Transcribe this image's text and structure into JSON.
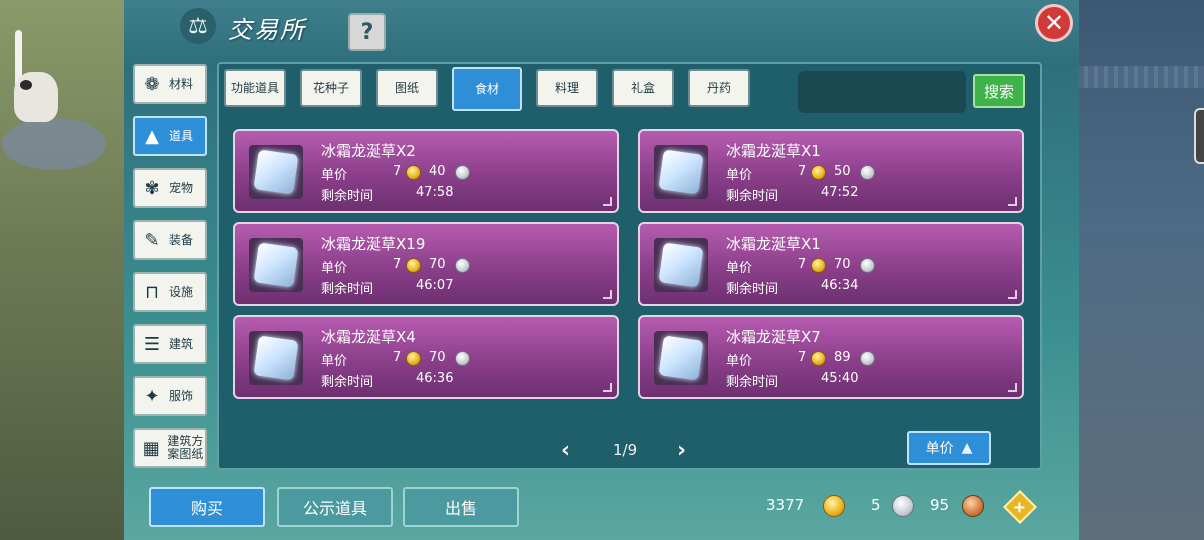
{
  "window": {
    "title": "交易所",
    "title_icon": "scale-icon",
    "help_label": "?",
    "close_label": "✕"
  },
  "sidebar": {
    "items": [
      {
        "label": "材料",
        "icon": "materials-icon",
        "glyph": "❁",
        "active": false
      },
      {
        "label": "道具",
        "icon": "props-icon",
        "glyph": "▲",
        "active": true
      },
      {
        "label": "宠物",
        "icon": "paw-icon",
        "glyph": "✾",
        "active": false
      },
      {
        "label": "装备",
        "icon": "equipment-icon",
        "glyph": "✎",
        "active": false
      },
      {
        "label": "设施",
        "icon": "facility-icon",
        "glyph": "⊓",
        "active": false
      },
      {
        "label": "建筑",
        "icon": "building-icon",
        "glyph": "☰",
        "active": false
      },
      {
        "label": "服饰",
        "icon": "clothing-icon",
        "glyph": "✦",
        "active": false
      },
      {
        "label": "建筑方案图纸",
        "icon": "blueprint-icon",
        "glyph": "▦",
        "active": false
      }
    ]
  },
  "categories": [
    {
      "label": "功能道具",
      "active": false
    },
    {
      "label": "花种子",
      "active": false
    },
    {
      "label": "图纸",
      "active": false
    },
    {
      "label": "食材",
      "active": true
    },
    {
      "label": "料理",
      "active": false
    },
    {
      "label": "礼盒",
      "active": false
    },
    {
      "label": "丹药",
      "active": false
    }
  ],
  "search": {
    "value": "",
    "button_label": "搜索"
  },
  "listings": [
    {
      "name": "冰霜龙涎草X2",
      "price_label": "单价",
      "gold": "7",
      "silver": "40",
      "time_label": "剩余时间",
      "time": "47:58"
    },
    {
      "name": "冰霜龙涎草X1",
      "price_label": "单价",
      "gold": "7",
      "silver": "50",
      "time_label": "剩余时间",
      "time": "47:52"
    },
    {
      "name": "冰霜龙涎草X19",
      "price_label": "单价",
      "gold": "7",
      "silver": "70",
      "time_label": "剩余时间",
      "time": "46:07"
    },
    {
      "name": "冰霜龙涎草X1",
      "price_label": "单价",
      "gold": "7",
      "silver": "70",
      "time_label": "剩余时间",
      "time": "46:34"
    },
    {
      "name": "冰霜龙涎草X4",
      "price_label": "单价",
      "gold": "7",
      "silver": "70",
      "time_label": "剩余时间",
      "time": "46:36"
    },
    {
      "name": "冰霜龙涎草X7",
      "price_label": "单价",
      "gold": "7",
      "silver": "89",
      "time_label": "剩余时间",
      "time": "45:40"
    }
  ],
  "pagination": {
    "prev": "‹",
    "page": "1/9",
    "next": "›"
  },
  "sort_button": {
    "label": "单价"
  },
  "bottom": {
    "buy_label": "购买",
    "show_label": "公示道具",
    "sell_label": "出售"
  },
  "currency": {
    "gold": "3377",
    "silver": "5",
    "bronze": "95"
  },
  "colors": {
    "accent_blue": "#2e8fd6",
    "search_green": "#3fb24a",
    "card_purple": "#8b3f8a",
    "close_red": "#d23a3a"
  }
}
